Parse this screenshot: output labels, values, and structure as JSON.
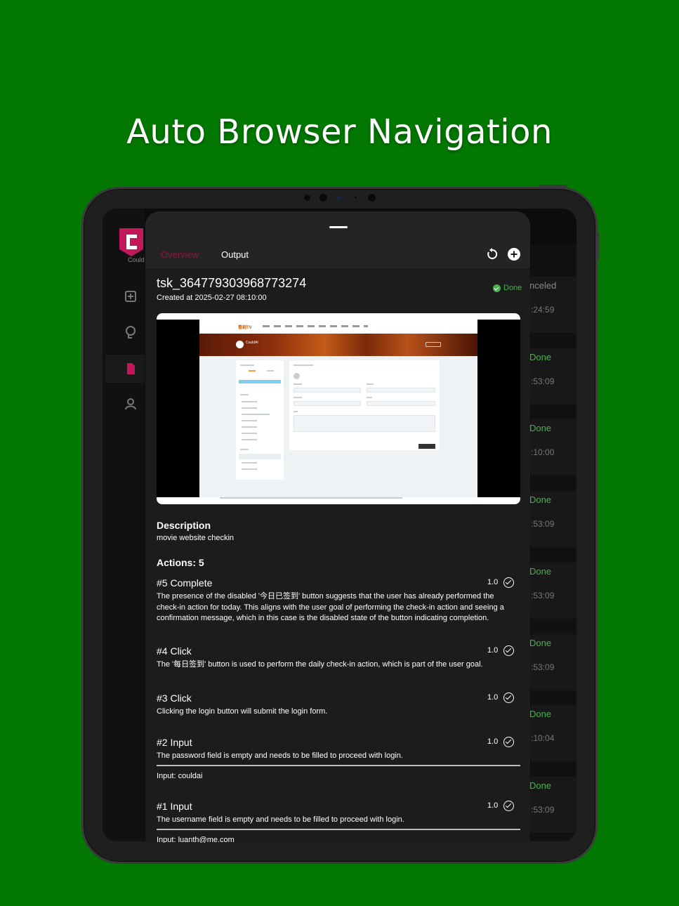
{
  "headline": "Auto Browser Navigation",
  "colors": {
    "background": "#027802",
    "accent": "#c2185b",
    "success": "#4caf50",
    "sheet": "#1c1c1c"
  },
  "background_app": {
    "logo_text": "Could",
    "nav_icons": [
      "add-task-icon",
      "brain-icon",
      "document-icon",
      "user-icon"
    ],
    "list_items": [
      {
        "status": "nceled",
        "time": ":24:59"
      },
      {
        "status": "Done",
        "time": ":53:09"
      },
      {
        "status": "Done",
        "time": ":10:00"
      },
      {
        "status": "Done",
        "time": ":53:09"
      },
      {
        "status": "Done",
        "time": ":53:09"
      },
      {
        "status": "Done",
        "time": ":53:09"
      },
      {
        "status": "Done",
        "time": ":10:04"
      },
      {
        "status": "Done",
        "time": ":53:09"
      }
    ]
  },
  "sheet": {
    "tabs": {
      "overview": "Overview",
      "output": "Output"
    },
    "task_id": "tsk_364779303968773274",
    "created": "Created at 2025-02-27 08:10:00",
    "status": "Done",
    "screenshot": {
      "site_logo": "看剧TV",
      "user_name": "CouldAI"
    },
    "description_title": "Description",
    "description": "movie website checkin",
    "actions_title": "Actions: 5",
    "actions": [
      {
        "title": "#5   Complete",
        "score": "1.0",
        "description": "The presence of the disabled '今日已签到' button suggests that the user has already performed the check-in action for today. This aligns with the user goal of performing the check-in action and seeing a confirmation message, which in this case is the disabled state of the button indicating completion.",
        "input": ""
      },
      {
        "title": "#4   Click",
        "score": "1.0",
        "description": "The '每日签到' button is used to perform the daily check-in action, which is part of the user goal.",
        "input": ""
      },
      {
        "title": "#3   Click",
        "score": "1.0",
        "description": "Clicking the login button will submit the login form.",
        "input": ""
      },
      {
        "title": "#2   Input",
        "score": "1.0",
        "description": "The password field is empty and needs to be filled to proceed with login.",
        "input": "Input:  couldai"
      },
      {
        "title": "#1   Input",
        "score": "1.0",
        "description": "The username field is empty and needs to be filled to proceed with login.",
        "input": "Input:  luanth@me.com"
      }
    ]
  }
}
